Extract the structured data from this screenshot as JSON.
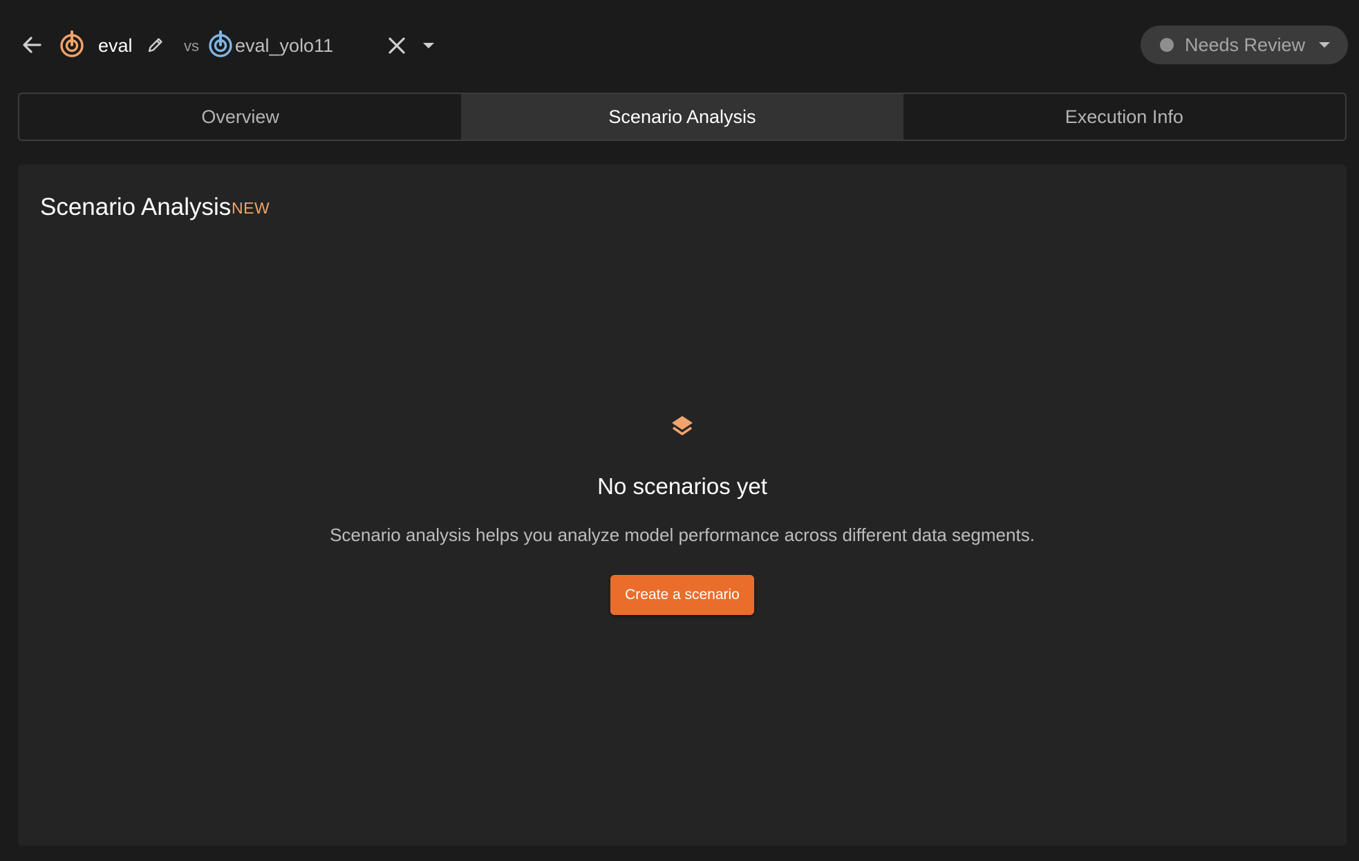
{
  "header": {
    "back_icon": "arrow-left-icon",
    "primary_run": {
      "name": "eval",
      "icon": "target-icon",
      "icon_color": "#f2a36b"
    },
    "edit_icon": "pencil-icon",
    "vs_label": "vs",
    "compare_run": {
      "name": "eval_yolo11",
      "icon": "target-icon",
      "icon_color": "#7fb6e6"
    },
    "close_icon": "close-icon",
    "dropdown_icon": "chevron-down-icon",
    "status": {
      "label": "Needs Review",
      "dot_color": "#8f8f8f"
    }
  },
  "tabs": [
    {
      "label": "Overview",
      "active": false
    },
    {
      "label": "Scenario Analysis",
      "active": true
    },
    {
      "label": "Execution Info",
      "active": false
    }
  ],
  "panel": {
    "title": "Scenario Analysis",
    "badge": "NEW",
    "empty_state": {
      "icon": "layers-icon",
      "title": "No scenarios yet",
      "description": "Scenario analysis helps you analyze model performance across different data segments.",
      "button_label": "Create a scenario"
    }
  },
  "colors": {
    "background": "#1b1b1b",
    "panel": "#242424",
    "accent": "#ea6d2b",
    "badge": "#f2a36b"
  }
}
